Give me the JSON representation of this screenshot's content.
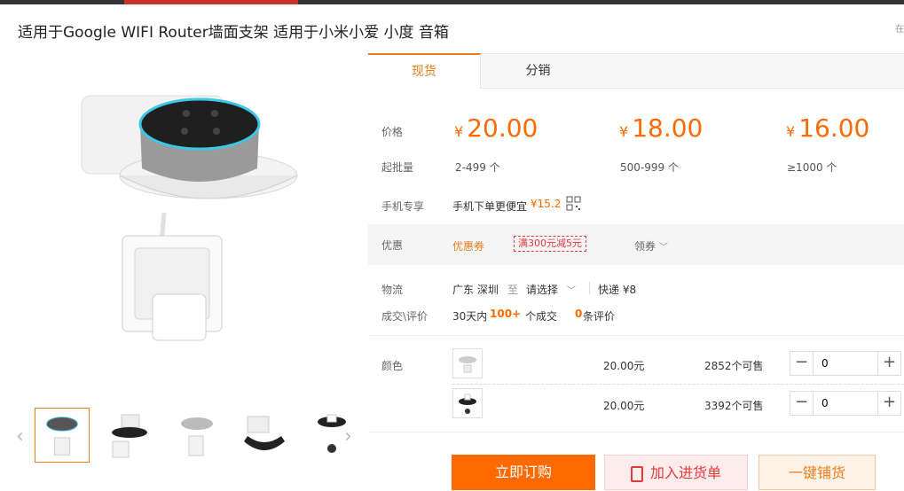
{
  "header": {
    "title": "适用于Google WIFI Router墙面支架 适用于小米小爱 小度 音箱",
    "right_text": "在"
  },
  "tabs": [
    {
      "label": "现货"
    },
    {
      "label": "分销"
    }
  ],
  "pricing": {
    "price_label": "价格",
    "moq_label": "起批量",
    "currency": "¥",
    "tiers": [
      {
        "price": "20.00",
        "range": "2-499 个"
      },
      {
        "price": "18.00",
        "range": "500-999 个"
      },
      {
        "price": "16.00",
        "range": "≥1000 个"
      }
    ]
  },
  "mobile": {
    "label": "手机专享",
    "text": "手机下单更便宜",
    "price": "¥15.2"
  },
  "promo": {
    "label": "优惠",
    "coupon_label": "优惠券",
    "coupon_tag": "满300元减5元",
    "claim_label": "领券"
  },
  "logistics": {
    "label": "物流",
    "from": "广东 深圳",
    "to_word": "至",
    "dest_placeholder": "请选择",
    "express": "快递 ¥8"
  },
  "deals": {
    "label": "成交\\评价",
    "period": "30天内",
    "count": "100+",
    "count_suffix": "个成交",
    "reviews": "0",
    "reviews_suffix": "条评价"
  },
  "sku": {
    "color_label": "颜色",
    "rows": [
      {
        "price": "20.00元",
        "stock": "2852个可售",
        "qty": "0"
      },
      {
        "price": "20.00元",
        "stock": "3392个可售",
        "qty": "0"
      }
    ]
  },
  "actions": {
    "buy_now": "立即订购",
    "add_cart": "加入进货单",
    "one_key": "一键铺货"
  },
  "colors": {
    "accent": "#ff6a00",
    "tab_accent": "#e87d1e",
    "coupon_red": "#e4393c"
  }
}
